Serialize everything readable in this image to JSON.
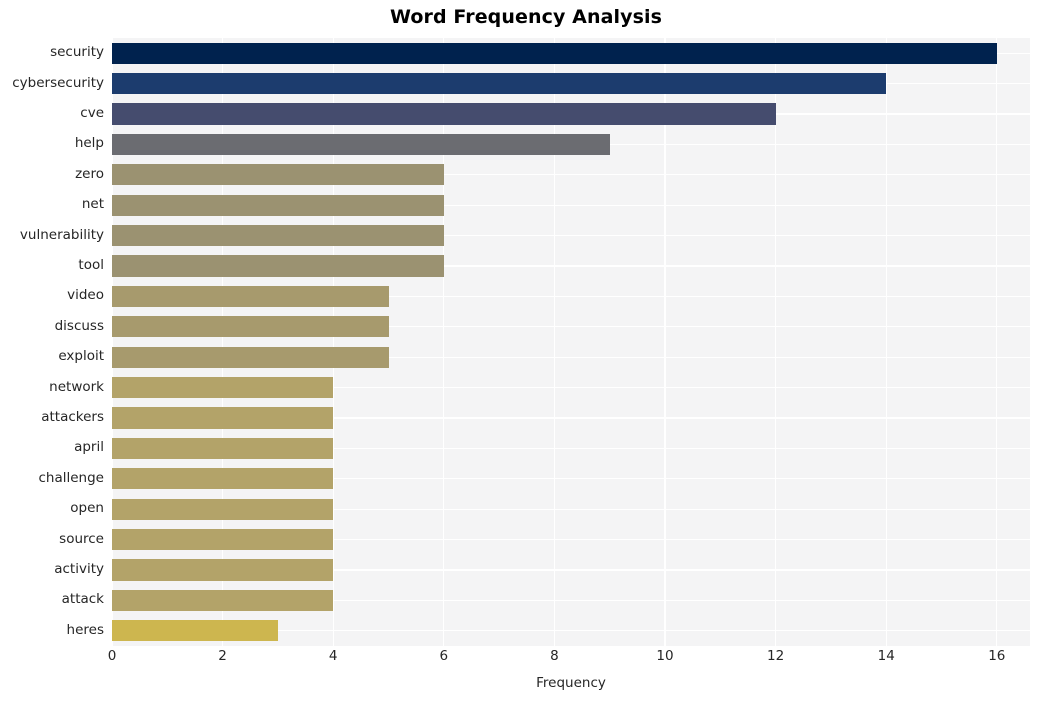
{
  "chart_data": {
    "type": "bar",
    "orientation": "horizontal",
    "title": "Word Frequency Analysis",
    "xlabel": "Frequency",
    "ylabel": "",
    "xlim": [
      0,
      16.6
    ],
    "xticks": [
      0,
      2,
      4,
      6,
      8,
      10,
      12,
      14,
      16
    ],
    "xtick_labels": [
      "0",
      "2",
      "4",
      "6",
      "8",
      "10",
      "12",
      "14",
      "16"
    ],
    "grid": true,
    "grid_axis": "both",
    "legend": null,
    "categories": [
      "security",
      "cybersecurity",
      "cve",
      "help",
      "zero",
      "net",
      "vulnerability",
      "tool",
      "video",
      "discuss",
      "exploit",
      "network",
      "attackers",
      "april",
      "challenge",
      "open",
      "source",
      "activity",
      "attack",
      "heres"
    ],
    "values": [
      16,
      14,
      12,
      9,
      6,
      6,
      6,
      6,
      5,
      5,
      5,
      4,
      4,
      4,
      4,
      4,
      4,
      4,
      4,
      3
    ],
    "bar_colors": [
      "#00224e",
      "#1c3c6e",
      "#454c6e",
      "#6b6c71",
      "#9b9271",
      "#9b9271",
      "#9b9271",
      "#9b9271",
      "#a79a6d",
      "#a79a6d",
      "#a79a6d",
      "#b3a369",
      "#b3a369",
      "#b3a369",
      "#b3a369",
      "#b3a369",
      "#b3a369",
      "#b3a369",
      "#b3a369",
      "#cdb64f"
    ],
    "colormap": "cividis_r",
    "plot_background": "#f4f4f5",
    "gridline_color": "#ffffff",
    "text_color": "#262626"
  }
}
